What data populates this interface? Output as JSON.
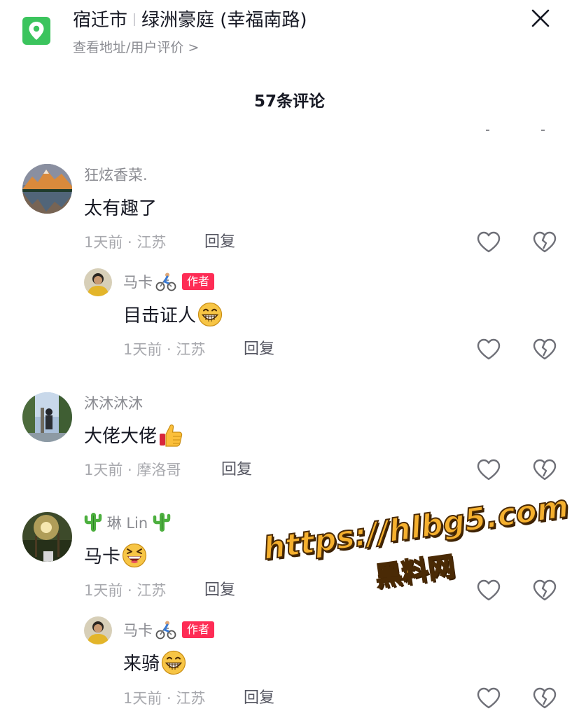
{
  "location": {
    "city": "宿迁市",
    "place": "绿洲豪庭 (幸福南路)",
    "subtitle": "查看地址/用户评价 >",
    "pin_icon": "location-pin-icon",
    "pin_color": "#3bc45d"
  },
  "close_icon": "close-icon",
  "comment_count_label": "57条评论",
  "accent_color": "#fe2c55",
  "comments": [
    {
      "username": "狂炫香菜.",
      "text": "太有趣了",
      "time": "1天前",
      "region": "江苏",
      "reply_label": "回复",
      "replies": [
        {
          "username": "马卡",
          "username_emoji": "cyclist-emoji",
          "badge": "作者",
          "text": "目击证人",
          "text_emoji": "grinning-face-emoji",
          "time": "1天前",
          "region": "江苏",
          "reply_label": "回复"
        }
      ]
    },
    {
      "username": "沐沐沐沐",
      "text": "大佬大佬",
      "text_emoji": "thumbs-up-emoji",
      "time": "1天前",
      "region": "摩洛哥",
      "reply_label": "回复"
    },
    {
      "username": "琳 Lin",
      "username_emoji": "cactus-emoji",
      "text": "马卡",
      "text_emoji": "laughing-face-emoji",
      "time": "1天前",
      "region": "江苏",
      "reply_label": "回复",
      "replies": [
        {
          "username": "马卡",
          "username_emoji": "cyclist-emoji",
          "badge": "作者",
          "text": "来骑",
          "text_emoji": "grinning-face-emoji",
          "time": "1天前",
          "region": "江苏",
          "reply_label": "回复"
        }
      ]
    }
  ],
  "watermark": {
    "line1": "https://hlbg5.com",
    "line2": "黑料网",
    "color": "#f5b02e"
  }
}
